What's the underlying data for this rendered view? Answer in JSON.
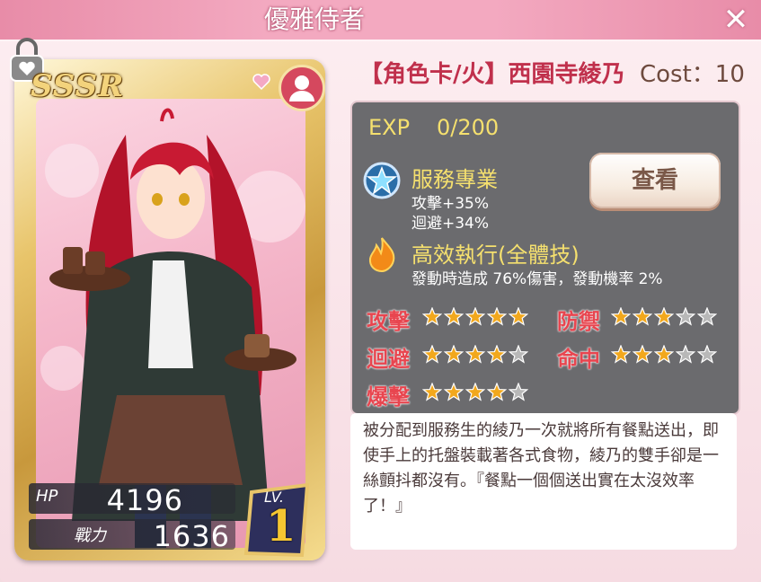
{
  "window": {
    "title": "優雅侍者"
  },
  "card": {
    "rarity": "SSSR",
    "hp_label": "HP",
    "hp_value": "4196",
    "power_label": "戰力",
    "power_value": "1636",
    "lv_label": "LV.",
    "lv_value": "1"
  },
  "character": {
    "name": "【角色卡/火】西園寺綾乃",
    "cost": "Cost：10"
  },
  "exp": {
    "label": "EXP",
    "value": "0/200"
  },
  "skill_1": {
    "name": "服務專業",
    "line1": "攻擊+35%",
    "line2": "迴避+34%",
    "icon": "star-badge-icon"
  },
  "skill_2": {
    "name": "高效執行(全體技)",
    "line1": "發動時造成 76%傷害，發動機率 2%",
    "icon": "flame-icon"
  },
  "view_button": "查看",
  "attributes": [
    {
      "label": "攻擊",
      "stars": 5
    },
    {
      "label": "防禦",
      "stars": 3
    },
    {
      "label": "迴避",
      "stars": 4
    },
    {
      "label": "命中",
      "stars": 3
    },
    {
      "label": "爆擊",
      "stars": 4
    }
  ],
  "description": "被分配到服務生的綾乃一次就將所有餐點送出，即使手上的托盤裝載著各式食物，綾乃的雙手卻是一絲顫抖都沒有。『餐點一個個送出實在太沒效率了！』",
  "colors": {
    "accent": "#e88ca8",
    "star_on": "#f2a81d",
    "star_off": "#b8b8b8",
    "attr_label": "#e8454f"
  }
}
